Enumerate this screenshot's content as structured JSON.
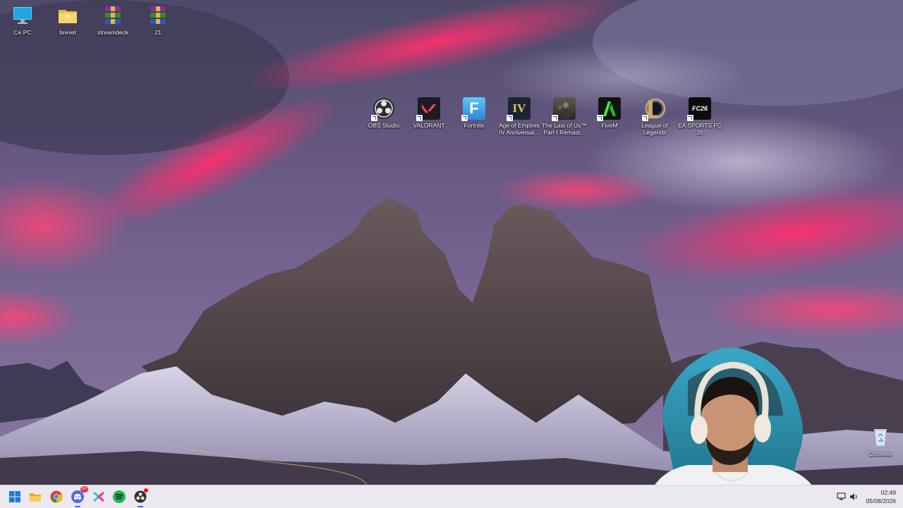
{
  "desktop": {
    "icons_left": [
      {
        "label": "Ce PC",
        "icon": "monitor-icon"
      },
      {
        "label": "brevet",
        "icon": "folder-icon"
      },
      {
        "label": "streamdeck",
        "icon": "winrar-archive-icon"
      },
      {
        "label": "21",
        "icon": "winrar-archive-icon"
      }
    ],
    "shortcuts": [
      {
        "label": "OBS Studio",
        "icon": "obs-icon"
      },
      {
        "label": "VALORANT",
        "icon": "valorant-icon"
      },
      {
        "label": "Fortnite",
        "icon": "fortnite-icon",
        "glyph": "F"
      },
      {
        "label": "Age of Empires IV Anniversar...",
        "icon": "age-of-empires-icon",
        "glyph": "IV"
      },
      {
        "label": "The Last of Us™ Part I Remast...",
        "icon": "the-last-of-us-icon"
      },
      {
        "label": "FiveM",
        "icon": "fivem-icon"
      },
      {
        "label": "League of Legends",
        "icon": "league-of-legends-icon",
        "glyph": "L"
      },
      {
        "label": "EA SPORTS FC 26",
        "icon": "ea-sports-fc-icon",
        "glyph": "FC26"
      }
    ],
    "recycle_bin": {
      "label": "Corbeille",
      "icon": "recycle-bin-icon"
    }
  },
  "taskbar": {
    "apps": [
      {
        "name": "start",
        "icon": "windows-start-icon"
      },
      {
        "name": "file-explorer",
        "icon": "file-explorer-icon"
      },
      {
        "name": "chrome",
        "icon": "chrome-icon"
      },
      {
        "name": "discord",
        "icon": "discord-icon",
        "badge": "9+"
      },
      {
        "name": "capcut",
        "icon": "capcut-icon"
      },
      {
        "name": "spotify",
        "icon": "spotify-icon"
      },
      {
        "name": "obs",
        "icon": "obs-taskbar-icon"
      }
    ],
    "tray": {
      "time": "02:49",
      "date": "05/08/2026",
      "icons": [
        "network-icon",
        "volume-icon"
      ]
    }
  },
  "colors": {
    "taskbar_bg": "#ece8f0",
    "accent": "#3a66d8",
    "sky_pink": "#ff2d6a",
    "sky_purple": "#5a4f7d"
  }
}
